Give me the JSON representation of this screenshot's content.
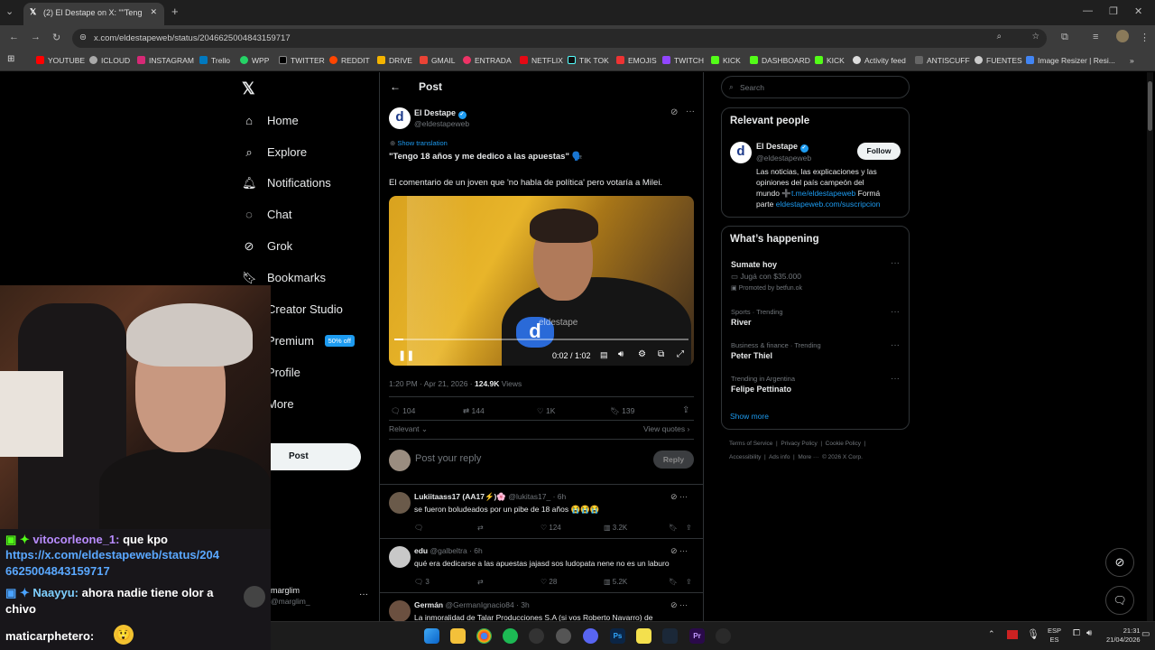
{
  "browser": {
    "tab_title": "(2) El Destape on X: \"\"Teng",
    "url": "x.com/eldestapeweb/status/2046625004843159717",
    "bookmarks": [
      "YOUTUBE",
      "ICLOUD",
      "INSTAGRAM",
      "Trello",
      "WPP",
      "TWITTER",
      "REDDIT",
      "DRIVE",
      "GMAIL",
      "ENTRADA",
      "NETFLIX",
      "TIK TOK",
      "EMOJIS",
      "TWITCH",
      "KICK",
      "DASHBOARD",
      "KICK",
      "Activity feed",
      "ANTISCUFF",
      "FUENTES",
      "Image Resizer | Resi..."
    ]
  },
  "nav": {
    "items": [
      "Home",
      "Explore",
      "Notifications",
      "Chat",
      "Grok",
      "Bookmarks",
      "Creator Studio",
      "Premium",
      "Profile",
      "More"
    ],
    "premium_badge": "50% off",
    "post_button": "Post",
    "account_name": "marglim",
    "account_handle": "@marglim_"
  },
  "post": {
    "header": "Post",
    "author_name": "El Destape",
    "author_handle": "@eldestapeweb",
    "show_translation": "Show translation",
    "title": "\"Tengo 18 años y me dedico a las apuestas\" 🗣️",
    "body": "El comentario de un joven que 'no habla de política' pero votaría a Milei.",
    "video_time": "0:02 / 1:02",
    "video_progress": 0.03,
    "video_watermark": "eldestape",
    "timestamp": "1:20 PM · Apr 21, 2026 · ",
    "views_count": "124.9K",
    "views_label": "Views",
    "replies": "104",
    "reposts": "144",
    "likes": "1K",
    "bookmarks": "139",
    "sort": "Relevant",
    "view_quotes": "View quotes",
    "reply_placeholder": "Post your reply",
    "reply_button": "Reply"
  },
  "replies": [
    {
      "name": "Lukiitaass17 (AA17⚡)🌸",
      "handle": "@lukitas17_",
      "time": "· 6h",
      "text": "se fueron boludeados por un pibe de 18 años 😭😭😭",
      "comments": "",
      "likes": "124",
      "views": "3.2K"
    },
    {
      "name": "edu",
      "handle": "@galbeltra",
      "time": "· 6h",
      "text": "qué era dedicarse a las apuestas jajasd sos ludopata nene no es un laburo",
      "comments": "3",
      "likes": "28",
      "views": "5.2K"
    },
    {
      "name": "Germán",
      "handle": "@GermanIgnacio84",
      "time": "· 3h",
      "text": "La inmoralidad de Talar Producciones S.A (si vos Roberto Navarro) de",
      "comments": "",
      "likes": "",
      "views": ""
    }
  ],
  "sidebar": {
    "search_placeholder": "Search",
    "relevant_title": "Relevant people",
    "follow": "Follow",
    "person_name": "El Destape",
    "person_handle": "@eldestapeweb",
    "bio_1": "Las noticias, las explicaciones y las",
    "bio_2": "opiniones del país campeón del",
    "bio_3": "mundo ➕",
    "bio_link_1": "t.me/eldestapeweb",
    "bio_4": " Formá",
    "bio_5": "parte ",
    "bio_link_2": "eldestapeweb.com/suscripcion",
    "happening_title": "What’s happening",
    "trends": [
      {
        "cat": "",
        "name": "Sumate hoy",
        "sub": "Jugá con $35.000",
        "promo": "Promoted by betfun.ok"
      },
      {
        "cat": "Sports · Trending",
        "name": "River"
      },
      {
        "cat": "Business & finance · Trending",
        "name": "Peter Thiel"
      },
      {
        "cat": "Trending in Argentina",
        "name": "Felipe Pettinato"
      }
    ],
    "show_more": "Show more",
    "footer_1": "Terms of Service  |  Privacy Policy  |  Cookie Policy  |",
    "footer_2": "Accessibility  |  Ads info  |  More ···  © 2026 X Corp."
  },
  "chat": [
    {
      "user": "vitocorleone_1:",
      "msg": " que kpo",
      "link": "https://x.com/eldestapeweb/status/204",
      "link2": "6625004843159717",
      "color": "#b98cff"
    },
    {
      "user": "Naayyu:",
      "msg": " ahora nadie tiene olor a",
      "msg2": "chivo",
      "color": "#7fd0ff"
    },
    {
      "user": "maticarphetero:",
      "color": "#ffffff"
    }
  ],
  "taskbar": {
    "lang_1": "ESP",
    "lang_2": "ES",
    "time": "21:31",
    "date": "21/04/2026"
  }
}
